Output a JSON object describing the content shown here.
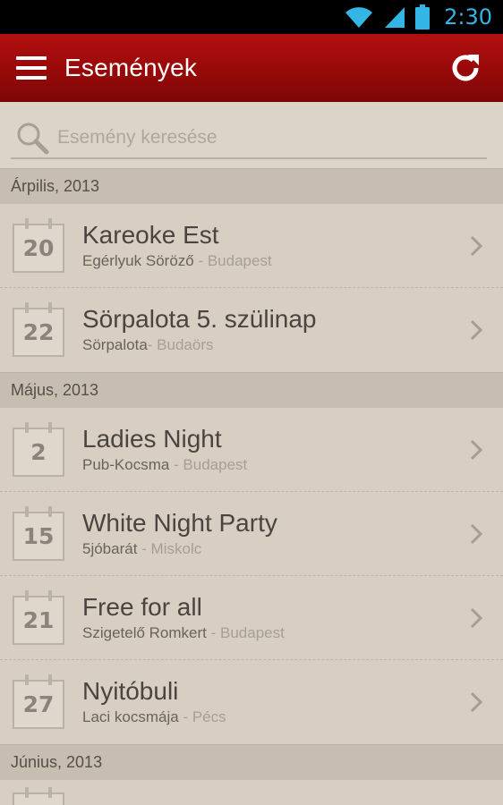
{
  "status": {
    "time": "2:30"
  },
  "appbar": {
    "title": "Események"
  },
  "search": {
    "placeholder": "Esemény keresése"
  },
  "sections": [
    {
      "label": "Árpilis, 2013",
      "events": [
        {
          "day": "20",
          "title": "Kareoke Est",
          "venue": "Egérlyuk Söröző",
          "city": " - Budapest"
        },
        {
          "day": "22",
          "title": "Sörpalota 5. szülinap",
          "venue": "Sörpalota",
          "city": "- Budaörs"
        }
      ]
    },
    {
      "label": "Május, 2013",
      "events": [
        {
          "day": "2",
          "title": "Ladies Night",
          "venue": "Pub-Kocsma",
          "city": " - Budapest"
        },
        {
          "day": "15",
          "title": "White Night Party",
          "venue": "5jóbarát",
          "city": " - Miskolc"
        },
        {
          "day": "21",
          "title": "Free for all",
          "venue": "Szigetelő Romkert",
          "city": " - Budapest"
        },
        {
          "day": "27",
          "title": "Nyitóbuli",
          "venue": "Laci kocsmája",
          "city": " - Pécs"
        }
      ]
    },
    {
      "label": "Június, 2013",
      "events": []
    }
  ],
  "icons": {
    "wifi": "wifi-icon",
    "signal": "signal-icon",
    "battery": "battery-icon",
    "menu": "menu-icon",
    "refresh": "refresh-icon",
    "search": "search-icon",
    "chevron": "chevron-right-icon"
  },
  "colors": {
    "appbar": "#9c0a0a",
    "status_accent": "#33b5e5",
    "background": "#d6cbbf"
  }
}
